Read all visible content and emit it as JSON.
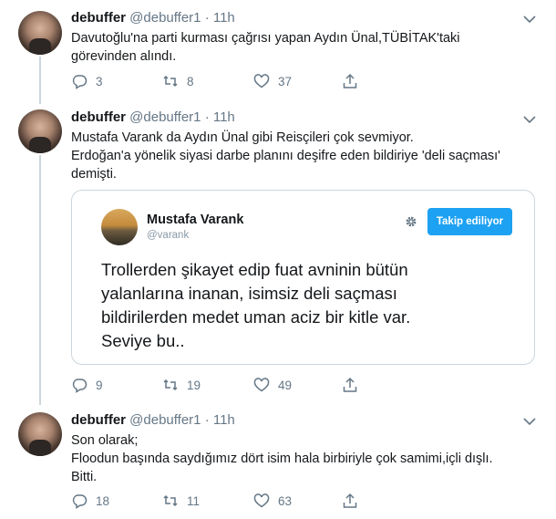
{
  "tweets": [
    {
      "name": "debuffer",
      "handle": "@debuffer1",
      "dot": "·",
      "time": "11h",
      "lines": [
        "Davutoğlu'na parti kurması çağrısı yapan Aydın Ünal,TÜBİTAK'taki",
        "görevinden alındı."
      ],
      "replies": "3",
      "retweets": "8",
      "likes": "37"
    },
    {
      "name": "debuffer",
      "handle": "@debuffer1",
      "dot": "·",
      "time": "11h",
      "lines": [
        "Mustafa Varank da Aydın Ünal gibi Reisçileri çok sevmiyor.",
        "Erdoğan'a yönelik siyasi darbe planını deşifre eden bildiriye 'deli saçması'",
        "demişti."
      ],
      "replies": "9",
      "retweets": "19",
      "likes": "49",
      "quote": {
        "name": "Mustafa Varank",
        "handle": "@varank",
        "follow_label": "Takip ediliyor",
        "lines": [
          "Trollerden şikayet edip fuat avninin bütün",
          "yalanlarına inanan, isimsiz deli saçması",
          "bildirilerden medet uman aciz bir kitle var.",
          "Seviye bu.."
        ]
      }
    },
    {
      "name": "debuffer",
      "handle": "@debuffer1",
      "dot": "·",
      "time": "11h",
      "lines": [
        "Son olarak;",
        "Floodun başında saydığımız dört isim hala birbiriyle çok samimi,içli dışlı.",
        "Bitti."
      ],
      "replies": "18",
      "retweets": "11",
      "likes": "63"
    }
  ],
  "colors": {
    "accent": "#1da1f2",
    "muted": "#657786",
    "text": "#14171a",
    "thread_line": "#ccd6dd"
  },
  "icons": [
    "reply-icon",
    "retweet-icon",
    "like-icon",
    "share-icon",
    "caret-down-icon",
    "gear-icon"
  ]
}
